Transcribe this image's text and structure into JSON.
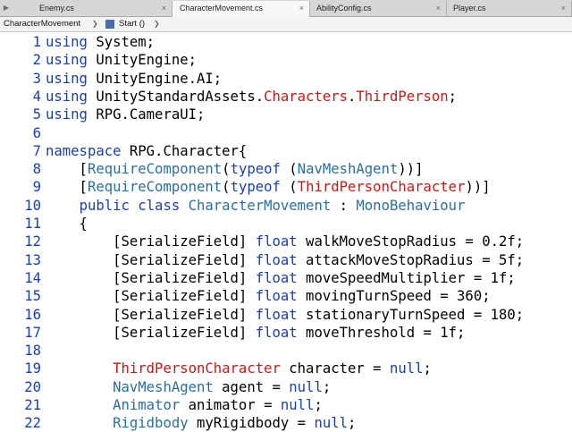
{
  "tabs": [
    {
      "label": "Enemy.cs",
      "close": "×"
    },
    {
      "label": "CharacterMovement.cs",
      "close": "×"
    },
    {
      "label": "AbilityConfig.cs",
      "close": "×"
    },
    {
      "label": "Player.cs",
      "close": "×"
    }
  ],
  "breadcrumb": {
    "class_name": "CharacterMovement",
    "method_name": "Start ()"
  },
  "code_lines": [
    {
      "n": "1",
      "tokens": [
        [
          "kw",
          "using"
        ],
        [
          "nm",
          " System;"
        ]
      ]
    },
    {
      "n": "2",
      "tokens": [
        [
          "kw",
          "using"
        ],
        [
          "nm",
          " UnityEngine;"
        ]
      ]
    },
    {
      "n": "3",
      "tokens": [
        [
          "kw",
          "using"
        ],
        [
          "nm",
          " UnityEngine.AI;"
        ]
      ]
    },
    {
      "n": "4",
      "tokens": [
        [
          "kw",
          "using"
        ],
        [
          "nm",
          " UnityStandardAssets."
        ],
        [
          "red",
          "Characters"
        ],
        [
          "nm",
          "."
        ],
        [
          "red",
          "ThirdPerson"
        ],
        [
          "nm",
          ";"
        ]
      ]
    },
    {
      "n": "5",
      "tokens": [
        [
          "kw",
          "using"
        ],
        [
          "nm",
          " RPG.CameraUI;"
        ]
      ]
    },
    {
      "n": "6",
      "tokens": []
    },
    {
      "n": "7",
      "tokens": [
        [
          "kw",
          "namespace"
        ],
        [
          "nm",
          " RPG.Character{"
        ]
      ]
    },
    {
      "n": "8",
      "tokens": [
        [
          "nm",
          "    ["
        ],
        [
          "ty",
          "RequireComponent"
        ],
        [
          "nm",
          "("
        ],
        [
          "kw",
          "typeof"
        ],
        [
          "nm",
          " ("
        ],
        [
          "ty",
          "NavMeshAgent"
        ],
        [
          "nm",
          "))]"
        ]
      ]
    },
    {
      "n": "9",
      "tokens": [
        [
          "nm",
          "    ["
        ],
        [
          "ty",
          "RequireComponent"
        ],
        [
          "nm",
          "("
        ],
        [
          "kw",
          "typeof"
        ],
        [
          "nm",
          " ("
        ],
        [
          "red",
          "ThirdPersonCharacter"
        ],
        [
          "nm",
          "))]"
        ]
      ]
    },
    {
      "n": "10",
      "tokens": [
        [
          "nm",
          "    "
        ],
        [
          "kw",
          "public class"
        ],
        [
          "nm",
          " "
        ],
        [
          "ty",
          "CharacterMovement"
        ],
        [
          "nm",
          " : "
        ],
        [
          "ty",
          "MonoBehaviour"
        ]
      ]
    },
    {
      "n": "11",
      "tokens": [
        [
          "nm",
          "    {"
        ]
      ]
    },
    {
      "n": "12",
      "tokens": [
        [
          "nm",
          "        [SerializeField] "
        ],
        [
          "kw",
          "float"
        ],
        [
          "nm",
          " walkMoveStopRadius = 0.2f;"
        ]
      ]
    },
    {
      "n": "13",
      "tokens": [
        [
          "nm",
          "        [SerializeField] "
        ],
        [
          "kw",
          "float"
        ],
        [
          "nm",
          " attackMoveStopRadius = 5f;"
        ]
      ]
    },
    {
      "n": "14",
      "tokens": [
        [
          "nm",
          "        [SerializeField] "
        ],
        [
          "kw",
          "float"
        ],
        [
          "nm",
          " moveSpeedMultiplier = 1f;"
        ]
      ]
    },
    {
      "n": "15",
      "tokens": [
        [
          "nm",
          "        [SerializeField] "
        ],
        [
          "kw",
          "float"
        ],
        [
          "nm",
          " movingTurnSpeed = 360;"
        ]
      ]
    },
    {
      "n": "16",
      "tokens": [
        [
          "nm",
          "        [SerializeField] "
        ],
        [
          "kw",
          "float"
        ],
        [
          "nm",
          " stationaryTurnSpeed = 180;"
        ]
      ]
    },
    {
      "n": "17",
      "tokens": [
        [
          "nm",
          "        [SerializeField] "
        ],
        [
          "kw",
          "float"
        ],
        [
          "nm",
          " moveThreshold = 1f;"
        ]
      ]
    },
    {
      "n": "18",
      "tokens": []
    },
    {
      "n": "19",
      "tokens": [
        [
          "nm",
          "        "
        ],
        [
          "red",
          "ThirdPersonCharacter"
        ],
        [
          "nm",
          " character = "
        ],
        [
          "kw",
          "null"
        ],
        [
          "nm",
          ";"
        ]
      ]
    },
    {
      "n": "20",
      "tokens": [
        [
          "nm",
          "        "
        ],
        [
          "ty",
          "NavMeshAgent"
        ],
        [
          "nm",
          " agent = "
        ],
        [
          "kw",
          "null"
        ],
        [
          "nm",
          ";"
        ]
      ]
    },
    {
      "n": "21",
      "tokens": [
        [
          "nm",
          "        "
        ],
        [
          "ty",
          "Animator"
        ],
        [
          "nm",
          " animator = "
        ],
        [
          "kw",
          "null"
        ],
        [
          "nm",
          ";"
        ]
      ]
    },
    {
      "n": "22",
      "tokens": [
        [
          "nm",
          "        "
        ],
        [
          "ty",
          "Rigidbody"
        ],
        [
          "nm",
          " myRigidbody = "
        ],
        [
          "kw",
          "null"
        ],
        [
          "nm",
          ";"
        ]
      ]
    }
  ],
  "colors": {
    "keyword": "#1a3fa8",
    "type": "#2a6ea0",
    "unresolved": "#c41a16",
    "line_number": "#1a3fa8"
  },
  "icons": {
    "tab_scroll": "play-right-icon",
    "method": "method-icon",
    "chevron": "chevron-right-icon"
  }
}
